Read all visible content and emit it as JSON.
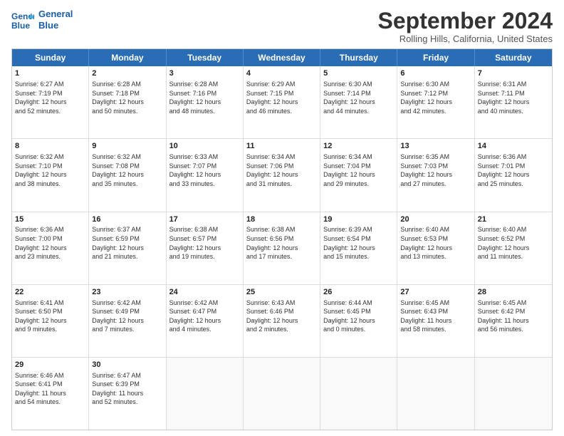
{
  "logo": {
    "line1": "General",
    "line2": "Blue"
  },
  "title": "September 2024",
  "location": "Rolling Hills, California, United States",
  "days_of_week": [
    "Sunday",
    "Monday",
    "Tuesday",
    "Wednesday",
    "Thursday",
    "Friday",
    "Saturday"
  ],
  "weeks": [
    [
      {
        "day": "1",
        "info": "Sunrise: 6:27 AM\nSunset: 7:19 PM\nDaylight: 12 hours\nand 52 minutes."
      },
      {
        "day": "2",
        "info": "Sunrise: 6:28 AM\nSunset: 7:18 PM\nDaylight: 12 hours\nand 50 minutes."
      },
      {
        "day": "3",
        "info": "Sunrise: 6:28 AM\nSunset: 7:16 PM\nDaylight: 12 hours\nand 48 minutes."
      },
      {
        "day": "4",
        "info": "Sunrise: 6:29 AM\nSunset: 7:15 PM\nDaylight: 12 hours\nand 46 minutes."
      },
      {
        "day": "5",
        "info": "Sunrise: 6:30 AM\nSunset: 7:14 PM\nDaylight: 12 hours\nand 44 minutes."
      },
      {
        "day": "6",
        "info": "Sunrise: 6:30 AM\nSunset: 7:12 PM\nDaylight: 12 hours\nand 42 minutes."
      },
      {
        "day": "7",
        "info": "Sunrise: 6:31 AM\nSunset: 7:11 PM\nDaylight: 12 hours\nand 40 minutes."
      }
    ],
    [
      {
        "day": "8",
        "info": "Sunrise: 6:32 AM\nSunset: 7:10 PM\nDaylight: 12 hours\nand 38 minutes."
      },
      {
        "day": "9",
        "info": "Sunrise: 6:32 AM\nSunset: 7:08 PM\nDaylight: 12 hours\nand 35 minutes."
      },
      {
        "day": "10",
        "info": "Sunrise: 6:33 AM\nSunset: 7:07 PM\nDaylight: 12 hours\nand 33 minutes."
      },
      {
        "day": "11",
        "info": "Sunrise: 6:34 AM\nSunset: 7:06 PM\nDaylight: 12 hours\nand 31 minutes."
      },
      {
        "day": "12",
        "info": "Sunrise: 6:34 AM\nSunset: 7:04 PM\nDaylight: 12 hours\nand 29 minutes."
      },
      {
        "day": "13",
        "info": "Sunrise: 6:35 AM\nSunset: 7:03 PM\nDaylight: 12 hours\nand 27 minutes."
      },
      {
        "day": "14",
        "info": "Sunrise: 6:36 AM\nSunset: 7:01 PM\nDaylight: 12 hours\nand 25 minutes."
      }
    ],
    [
      {
        "day": "15",
        "info": "Sunrise: 6:36 AM\nSunset: 7:00 PM\nDaylight: 12 hours\nand 23 minutes."
      },
      {
        "day": "16",
        "info": "Sunrise: 6:37 AM\nSunset: 6:59 PM\nDaylight: 12 hours\nand 21 minutes."
      },
      {
        "day": "17",
        "info": "Sunrise: 6:38 AM\nSunset: 6:57 PM\nDaylight: 12 hours\nand 19 minutes."
      },
      {
        "day": "18",
        "info": "Sunrise: 6:38 AM\nSunset: 6:56 PM\nDaylight: 12 hours\nand 17 minutes."
      },
      {
        "day": "19",
        "info": "Sunrise: 6:39 AM\nSunset: 6:54 PM\nDaylight: 12 hours\nand 15 minutes."
      },
      {
        "day": "20",
        "info": "Sunrise: 6:40 AM\nSunset: 6:53 PM\nDaylight: 12 hours\nand 13 minutes."
      },
      {
        "day": "21",
        "info": "Sunrise: 6:40 AM\nSunset: 6:52 PM\nDaylight: 12 hours\nand 11 minutes."
      }
    ],
    [
      {
        "day": "22",
        "info": "Sunrise: 6:41 AM\nSunset: 6:50 PM\nDaylight: 12 hours\nand 9 minutes."
      },
      {
        "day": "23",
        "info": "Sunrise: 6:42 AM\nSunset: 6:49 PM\nDaylight: 12 hours\nand 7 minutes."
      },
      {
        "day": "24",
        "info": "Sunrise: 6:42 AM\nSunset: 6:47 PM\nDaylight: 12 hours\nand 4 minutes."
      },
      {
        "day": "25",
        "info": "Sunrise: 6:43 AM\nSunset: 6:46 PM\nDaylight: 12 hours\nand 2 minutes."
      },
      {
        "day": "26",
        "info": "Sunrise: 6:44 AM\nSunset: 6:45 PM\nDaylight: 12 hours\nand 0 minutes."
      },
      {
        "day": "27",
        "info": "Sunrise: 6:45 AM\nSunset: 6:43 PM\nDaylight: 11 hours\nand 58 minutes."
      },
      {
        "day": "28",
        "info": "Sunrise: 6:45 AM\nSunset: 6:42 PM\nDaylight: 11 hours\nand 56 minutes."
      }
    ],
    [
      {
        "day": "29",
        "info": "Sunrise: 6:46 AM\nSunset: 6:41 PM\nDaylight: 11 hours\nand 54 minutes."
      },
      {
        "day": "30",
        "info": "Sunrise: 6:47 AM\nSunset: 6:39 PM\nDaylight: 11 hours\nand 52 minutes."
      },
      {
        "day": "",
        "info": ""
      },
      {
        "day": "",
        "info": ""
      },
      {
        "day": "",
        "info": ""
      },
      {
        "day": "",
        "info": ""
      },
      {
        "day": "",
        "info": ""
      }
    ]
  ]
}
